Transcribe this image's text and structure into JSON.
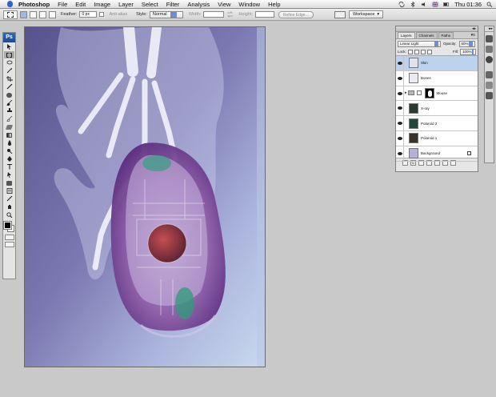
{
  "menubar": {
    "app_name": "Photoshop",
    "items": [
      "File",
      "Edit",
      "Image",
      "Layer",
      "Select",
      "Filter",
      "Analysis",
      "View",
      "Window",
      "Help"
    ],
    "clock": "Thu 01:36"
  },
  "options_bar": {
    "feather_label": "Feather:",
    "feather_value": "0 px",
    "antialias_label": "Anti-alias",
    "style_label": "Style:",
    "style_value": "Normal",
    "width_label": "Width:",
    "height_label": "Height:",
    "refine_edge_label": "Refine Edge...",
    "workspace_label": "Workspace"
  },
  "toolbox": {
    "logo": "Ps"
  },
  "layers_palette": {
    "tabs": [
      "Layers",
      "Channels",
      "Paths"
    ],
    "blend_mode": "Linear Light",
    "opacity_label": "Opacity:",
    "opacity_value": "50%",
    "lock_label": "Lock:",
    "fill_label": "Fill:",
    "fill_value": "100%",
    "layers": [
      {
        "name": "Skin",
        "selected": true,
        "thumb_color": "#dfe3ee"
      },
      {
        "name": "Bones",
        "selected": false,
        "thumb_color": "#e9e9ef"
      },
      {
        "name": "Mouse",
        "selected": false,
        "thumb_color": "#000000"
      },
      {
        "name": "X-ray",
        "selected": false,
        "thumb_color": "#2a3a30"
      },
      {
        "name": "Polaroid 2",
        "selected": false,
        "thumb_color": "#1f4a3a"
      },
      {
        "name": "Polaroid 1",
        "selected": false,
        "thumb_color": "#3a3226"
      },
      {
        "name": "Background",
        "selected": false,
        "thumb_color": "#b4b0d8"
      }
    ],
    "bottom_buttons": [
      "link-layers",
      "fx",
      "add-mask",
      "adjustment",
      "new-group",
      "new-layer",
      "delete"
    ]
  },
  "colors": {
    "accent": "#2f6db8",
    "selection": "#bdd2ec",
    "canvas_base": "#5c5a8e"
  }
}
